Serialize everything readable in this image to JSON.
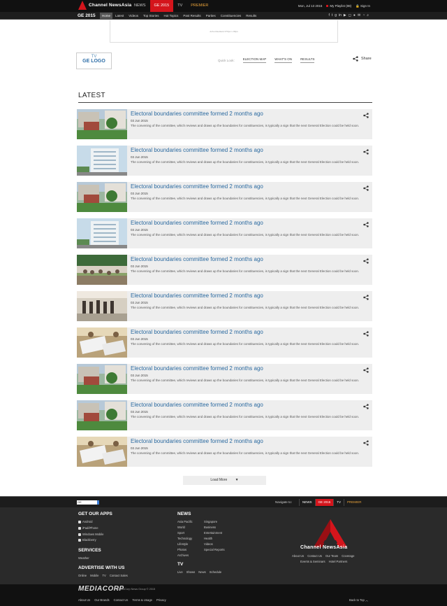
{
  "topbar": {
    "brand": "Channel NewsAsia",
    "nav": [
      "NEWS",
      "GE 2015",
      "TV",
      "PREMIER"
    ],
    "date": "Mon, Jul 13 2015",
    "playlist": "My Playlist (88)",
    "signin": "Sign In"
  },
  "subbar": {
    "title": "GE 2015",
    "nav": [
      "Home",
      "Latest",
      "Videos",
      "Top Stories",
      "Hot Topics",
      "Past Results",
      "Parties",
      "Constituencies",
      "Results"
    ]
  },
  "ad": {
    "text": "Advertisement 970px x 90px"
  },
  "header": {
    "tv_logo_line1": "TV",
    "tv_logo_line2": "GE LOGO",
    "quick_look": "Quick Look:",
    "links": [
      "ELECTION MAP",
      "WHAT'S ON",
      "RESULTS"
    ],
    "share": "Share"
  },
  "latest": {
    "heading": "LATEST",
    "articles": [
      {
        "title": "Electoral boundaries committee formed 2 months ago",
        "date": "03 Jun 2015",
        "desc": "The convening of the committee, which reviews and draws up the boundaries for constituencies, is typically a sign that the next General Election could be held soon.",
        "thumb": "garden"
      },
      {
        "title": "Electoral boundaries committee formed 2 months ago",
        "date": "03 Jun 2015",
        "desc": "The convening of the committee, which reviews and draws up the boundaries for constituencies, is typically a sign that the next General Election could be held soon.",
        "thumb": "building"
      },
      {
        "title": "Electoral boundaries committee formed 2 months ago",
        "date": "03 Jun 2015",
        "desc": "The convening of the committee, which reviews and draws up the boundaries for constituencies, is typically a sign that the next General Election could be held soon.",
        "thumb": "garden"
      },
      {
        "title": "Electoral boundaries committee formed 2 months ago",
        "date": "03 Jun 2015",
        "desc": "The convening of the committee, which reviews and draws up the boundaries for constituencies, is typically a sign that the next General Election could be held soon.",
        "thumb": "building"
      },
      {
        "title": "Electoral boundaries committee formed 2 months ago",
        "date": "03 Jun 2015",
        "desc": "The convening of the committee, which reviews and draws up the boundaries for constituencies, is typically a sign that the next General Election could be held soon.",
        "thumb": "crowd"
      },
      {
        "title": "Electoral boundaries committee formed 2 months ago",
        "date": "03 Jun 2015",
        "desc": "The convening of the committee, which reviews and draws up the boundaries for constituencies, is typically a sign that the next General Election could be held soon.",
        "thumb": "queue"
      },
      {
        "title": "Electoral boundaries committee formed 2 months ago",
        "date": "03 Jun 2015",
        "desc": "The convening of the committee, which reviews and draws up the boundaries for constituencies, is typically a sign that the next General Election could be held soon.",
        "thumb": "counting"
      },
      {
        "title": "Electoral boundaries committee formed 2 months ago",
        "date": "03 Jun 2015",
        "desc": "The convening of the committee, which reviews and draws up the boundaries for constituencies, is typically a sign that the next General Election could be held soon.",
        "thumb": "garden"
      },
      {
        "title": "Electoral boundaries committee formed 2 months ago",
        "date": "03 Jun 2015",
        "desc": "The convening of the committee, which reviews and draws up the boundaries for constituencies, is typically a sign that the next General Election could be held soon.",
        "thumb": "garden"
      },
      {
        "title": "Electoral boundaries committee formed 2 months ago",
        "date": "03 Jun 2015",
        "desc": "The convening of the committee, which reviews and draws up the boundaries for constituencies, is typically a sign that the next General Election could be held soon.",
        "thumb": "counting"
      }
    ],
    "load_more": "Load More"
  },
  "footer_nav": {
    "search_value": "GE",
    "navigate_to": "Navigate to:",
    "links": [
      "NEWS",
      "GE 2015",
      "TV",
      "PREMIER"
    ]
  },
  "footer": {
    "apps_heading": "GET OUR APPS",
    "apps": [
      "Android",
      "iPad/iPhone",
      "Windows Mobile",
      "Blackberry"
    ],
    "services_heading": "SERVICES",
    "services": [
      "Weather"
    ],
    "advertise_heading": "ADVERTISE WITH US",
    "advertise": [
      "Online",
      "Mobile",
      "TV",
      "Contact Sales"
    ],
    "news_heading": "NEWS",
    "news_col1": [
      "Asia Pacific",
      "World",
      "Sport",
      "Technology",
      "Lifestyle",
      "Photos",
      "Archives"
    ],
    "news_col2": [
      "Singapore",
      "Business",
      "Entertainment",
      "Health",
      "Videos",
      "Special Reports"
    ],
    "tv_heading": "TV",
    "tv": [
      "Live",
      "Shows",
      "News",
      "Schedule"
    ],
    "brand": "Channel NewsAsia",
    "about_row1": [
      "About Us",
      "Contact Us",
      "Our Team",
      "Coverage"
    ],
    "about_row2": [
      "Events & Seminars",
      "Hotel Partners"
    ]
  },
  "bottom": {
    "mediacorp": "MEDIACORP",
    "copyright": "MediaCorp News Group © 2015",
    "links": [
      "About Us",
      "Our Brands",
      "Contact Us",
      "Terms & Usage",
      "Privacy"
    ],
    "back_to_top": "Back to Top"
  },
  "colors": {
    "accent": "#d4151c",
    "link": "#2b6aa0",
    "premier": "#e8a23a"
  }
}
